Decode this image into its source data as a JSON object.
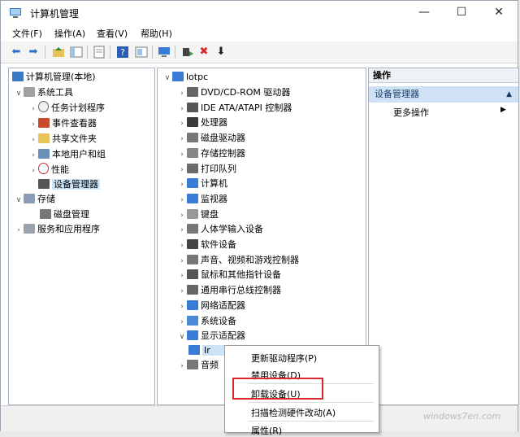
{
  "window": {
    "title": "计算机管理",
    "caption": {
      "minimize": "—",
      "maximize": "☐",
      "close": "✕"
    },
    "colors": {
      "selection": "#cce4f7",
      "action_section": "#cfe1f4",
      "highlight_box": "#d8272d"
    }
  },
  "menu": [
    "文件(F)",
    "操作(A)",
    "查看(V)",
    "帮助(H)"
  ],
  "toolbar": {
    "icons": [
      "back-arrow-icon",
      "forward-arrow-icon",
      "up-folder-icon",
      "show-hide-tree-icon",
      "properties-icon",
      "help-icon",
      "help-page-icon",
      "monitor-icon",
      "update-driver-icon",
      "uninstall-x-icon",
      "download-circle-icon"
    ],
    "glyphs": {
      "back": "⬅",
      "forward": "➡",
      "close_x": "✖",
      "down": "⬇"
    }
  },
  "tree": {
    "root": "计算机管理(本地)",
    "system_tools": "系统工具",
    "task_scheduler": "任务计划程序",
    "event_viewer": "事件查看器",
    "shared_folders": "共享文件夹",
    "local_users": "本地用户和组",
    "performance": "性能",
    "device_manager": "设备管理器",
    "storage": "存储",
    "disk_management": "磁盘管理",
    "services": "服务和应用程序"
  },
  "devices": {
    "computer_name": "lotpc",
    "items": [
      "DVD/CD-ROM 驱动器",
      "IDE ATA/ATAPI 控制器",
      "处理器",
      "磁盘驱动器",
      "存储控制器",
      "打印队列",
      "计算机",
      "监视器",
      "键盘",
      "人体学输入设备",
      "软件设备",
      "声音、视频和游戏控制器",
      "鼠标和其他指针设备",
      "通用串行总线控制器",
      "网络适配器",
      "系统设备",
      "显示适配器"
    ],
    "display_child": "Ir",
    "sound_partial": "音频"
  },
  "actions": {
    "header": "操作",
    "section": "设备管理器",
    "more": "更多操作"
  },
  "context_menu": {
    "update_driver": "更新驱动程序(P)",
    "disable": "禁用设备(D)",
    "uninstall": "卸载设备(U)",
    "scan": "扫描检测硬件改动(A)",
    "properties": "属性(R)"
  },
  "watermark": "windows7en.com"
}
